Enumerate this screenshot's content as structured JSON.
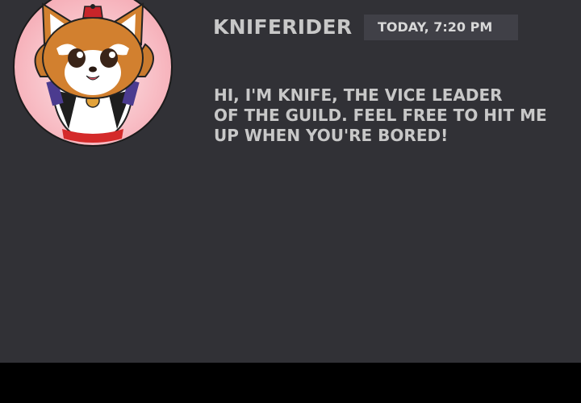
{
  "post": {
    "username": "KNIFERIDER",
    "timestamp": "TODAY, 7:20 PM",
    "message_lines": [
      "HI, I'M KNIFE, THE VICE LEADER",
      "OF THE GUILD. FEEL FREE TO HIT ME",
      "UP WHEN YOU'RE BORED!"
    ]
  },
  "colors": {
    "panel_background": "#313136",
    "bottom_bar": "#000000",
    "timestamp_background": "#404047",
    "text": "#c8c8c8",
    "avatar_background": "#f7c6cb"
  },
  "avatar": {
    "icon": "red-panda-avatar-icon"
  }
}
